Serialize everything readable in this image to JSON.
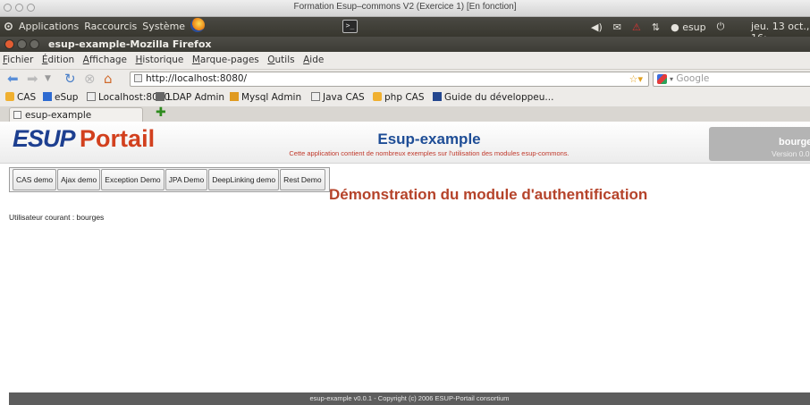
{
  "mac_window": {
    "title": "Formation Esup–commons V2 (Exercice 1) [En fonction]"
  },
  "top_panel": {
    "menus": [
      "Applications",
      "Raccourcis",
      "Système"
    ],
    "tray_user": "esup",
    "clock": "jeu. 13 oct., 16:"
  },
  "firefox_window": {
    "title": "esup-example-Mozilla Firefox"
  },
  "menubar": [
    "Fichier",
    "Édition",
    "Affichage",
    "Historique",
    "Marque-pages",
    "Outils",
    "Aide"
  ],
  "navbar": {
    "url": "http://localhost:8080/",
    "search_placeholder": "Google"
  },
  "bookmarks": [
    "CAS",
    "eSup",
    "Localhost:8080",
    "LDAP Admin",
    "Mysql Admin",
    "Java CAS",
    "php CAS",
    "Guide du développeu..."
  ],
  "tabs": [
    {
      "label": "esup-example"
    }
  ],
  "page": {
    "logo": {
      "part1": "ESUP",
      "part2": "Portail"
    },
    "app_title": "Esup-example",
    "app_description": "Cette application contient de nombreux exemples sur l'utilisation des modules esup-commons.",
    "user_box": {
      "username": "bourges",
      "version": "Version 0.0.1"
    },
    "demo_nav": [
      "CAS demo",
      "Ajax demo",
      "Exception Demo",
      "JPA Demo",
      "DeepLinking demo",
      "Rest Demo"
    ],
    "heading": "Démonstration du module d'authentification",
    "current_user": "Utilisateur courant : bourges",
    "footer": "esup-example v0.0.1 - Copyright (c) 2006 ESUP-Portail consortium"
  }
}
